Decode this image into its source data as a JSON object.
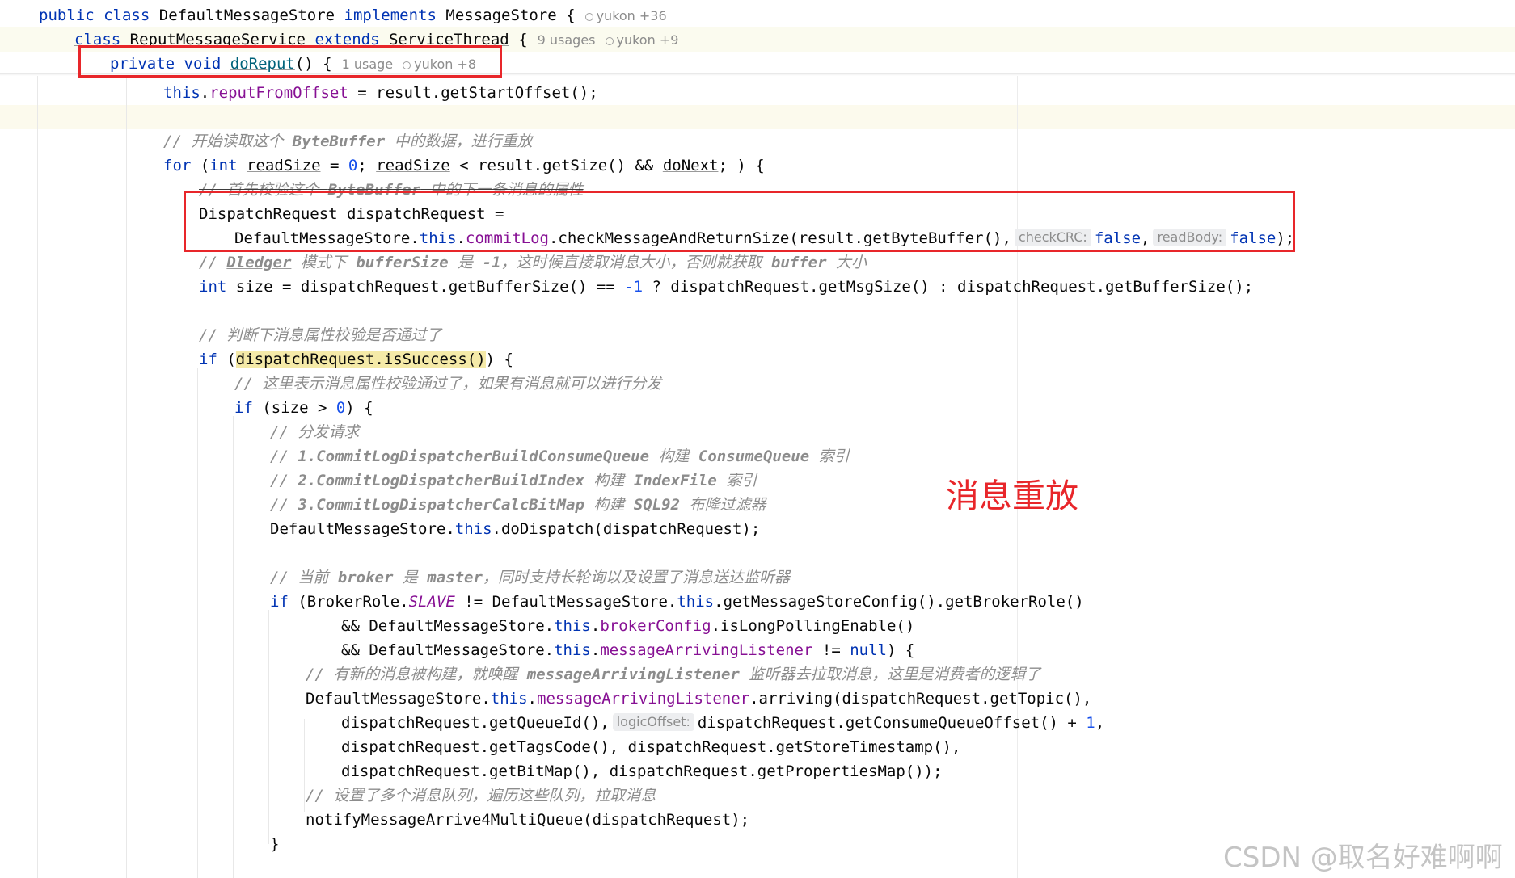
{
  "editor": {
    "sticky_header": {
      "class_decl": {
        "kw_public": "public",
        "kw_class": "class",
        "name": "DefaultMessageStore",
        "kw_implements": "implements",
        "iface": "MessageStore",
        "brace": "{",
        "author": "yukon +36"
      },
      "inner_class_decl": {
        "kw_class": "class",
        "name": "ReputMessageService",
        "kw_extends": "extends",
        "parent": "ServiceThread",
        "brace": "{",
        "usages": "9 usages",
        "author": "yukon +9"
      },
      "method_decl": {
        "kw_private": "private",
        "kw_void": "void",
        "name": "doReput",
        "sig": "() {",
        "usages": "1 usage",
        "author": "yukon +8"
      }
    },
    "code": {
      "l1": {
        "kw_this": "this",
        "dot": ".",
        "field": "reputFromOffset",
        "rest": " = result.getStartOffset();"
      },
      "l2": {
        "comment": "// 开始读取这个 ",
        "comment_b": "ByteBuffer",
        "comment2": " 中的数据，进行重放"
      },
      "l3": {
        "kw_for": "for",
        "p1": " (",
        "kw_int": "int",
        "sp": " ",
        "var1": "readSize",
        "eq": " = ",
        "zero": "0",
        "semi": "; ",
        "var2": "readSize",
        "lt": " < result.getSize() && ",
        "var3": "doNext",
        "end": "; ) {"
      },
      "l4": {
        "comment": "// 首先校验这个 ",
        "comment_b": "ByteBuffer",
        "comment2": " 中的下一条消息的属性"
      },
      "l5": {
        "text": "DispatchRequest dispatchRequest ="
      },
      "l6": {
        "pre": "DefaultMessageStore.",
        "kw_this": "this",
        "dot": ".",
        "field": "commitLog",
        "call": ".checkMessageAndReturnSize(result.getByteBuffer(),",
        "hint1": "checkCRC:",
        "val1": "false",
        "comma": ",",
        "hint2": "readBody:",
        "val2": "false",
        "end": ");"
      },
      "l7": {
        "comment": "// ",
        "comment_b1": "Dledger",
        "comment2": " 模式下 ",
        "comment_b2": "bufferSize",
        "comment3": " 是 ",
        "comment_b3": "-1",
        "comment4": "，这时候直接取消息大小，否则就获取 ",
        "comment_b4": "buffer",
        "comment5": " 大小"
      },
      "l8": {
        "kw_int": "int",
        "mid": " size = dispatchRequest.getBufferSize() == ",
        "num": "-1",
        "rest": " ? dispatchRequest.getMsgSize() : dispatchRequest.getBufferSize();"
      },
      "l9": {
        "comment": "// 判断下消息属性校验是否通过了"
      },
      "l10": {
        "kw_if": "if",
        "p1": " (",
        "match": "dispatchRequest.isSuccess()",
        "end": ") {"
      },
      "l11": {
        "comment": "// 这里表示消息属性校验通过了，如果有消息就可以进行分发"
      },
      "l12": {
        "kw_if": "if",
        "mid": " (size > ",
        "num": "0",
        "end": ") {"
      },
      "l13": {
        "comment": "// 分发请求"
      },
      "l14": {
        "comment": "// ",
        "comment_b1": "1.CommitLogDispatcherBuildConsumeQueue",
        "comment2": " 构建 ",
        "comment_b2": "ConsumeQueue",
        "comment3": " 索引"
      },
      "l15": {
        "comment": "// ",
        "comment_b1": "2.CommitLogDispatcherBuildIndex",
        "comment2": " 构建 ",
        "comment_b2": "IndexFile",
        "comment3": " 索引"
      },
      "l16": {
        "comment": "// ",
        "comment_b1": "3.CommitLogDispatcherCalcBitMap",
        "comment2": " 构建 ",
        "comment_b2": "SQL92",
        "comment3": " 布隆过滤器"
      },
      "l17": {
        "pre": "DefaultMessageStore.",
        "kw_this": "this",
        "rest": ".doDispatch(dispatchRequest);"
      },
      "l18": {
        "comment": "// 当前 ",
        "comment_b1": "broker",
        "comment2": " 是 ",
        "comment_b2": "master",
        "comment3": "，同时支持长轮询以及设置了消息送达监听器"
      },
      "l19": {
        "kw_if": "if",
        "pre": " (BrokerRole.",
        "static": "SLAVE",
        "mid": " != DefaultMessageStore.",
        "kw_this": "this",
        "rest": ".getMessageStoreConfig().getBrokerRole()"
      },
      "l20": {
        "pre": "&& DefaultMessageStore.",
        "kw_this": "this",
        "dot": ".",
        "field": "brokerConfig",
        "rest": ".isLongPollingEnable()"
      },
      "l21": {
        "pre": "&& DefaultMessageStore.",
        "kw_this": "this",
        "dot": ".",
        "field": "messageArrivingListener",
        "mid": " != ",
        "kw_null": "null",
        "end": ") {"
      },
      "l22": {
        "comment": "// 有新的消息被构建，就唤醒 ",
        "comment_b": "messageArrivingListener",
        "comment2": " 监听器去拉取消息，这里是消费者的逻辑了"
      },
      "l23": {
        "pre": "DefaultMessageStore.",
        "kw_this": "this",
        "dot": ".",
        "field": "messageArrivingListener",
        "rest": ".arriving(dispatchRequest.getTopic(),"
      },
      "l24": {
        "pre": "dispatchRequest.getQueueId(),",
        "hint": "logicOffset:",
        "mid": "dispatchRequest.getConsumeQueueOffset() + ",
        "num": "1",
        "end": ","
      },
      "l25": {
        "text": "dispatchRequest.getTagsCode(), dispatchRequest.getStoreTimestamp(),"
      },
      "l26": {
        "text": "dispatchRequest.getBitMap(), dispatchRequest.getPropertiesMap());"
      },
      "l27": {
        "comment": "// 设置了多个消息队列，遍历这些队列，拉取消息"
      },
      "l28": {
        "text": "notifyMessageArrive4MultiQueue(dispatchRequest);"
      },
      "l29": {
        "text": "}"
      }
    },
    "colors": {
      "keyword": "#0033b3",
      "field": "#871094",
      "number": "#1750eb",
      "comment": "#8c8c8c",
      "method_def": "#00627a",
      "annotation_red": "#e8262a"
    }
  },
  "annotation": {
    "text": "消息重放"
  },
  "watermark": {
    "text": "CSDN @取名好难啊啊"
  }
}
